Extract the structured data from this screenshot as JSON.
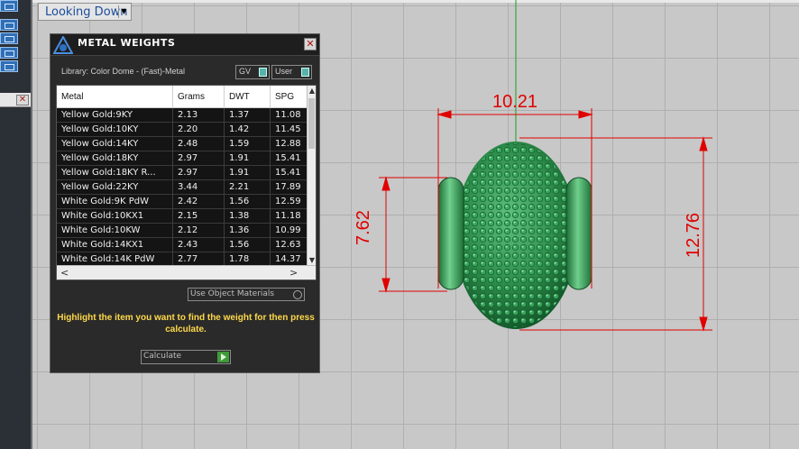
{
  "view": {
    "tab_label": "Looking Down",
    "dropdown_icon": "chevron-down-icon"
  },
  "dialog": {
    "title": "METAL WEIGHTS",
    "library": "Library: Color Dome - (Fast)-Metal",
    "toggles": [
      {
        "label": "GV"
      },
      {
        "label": "User"
      }
    ],
    "columns": [
      "Metal",
      "Grams",
      "DWT",
      "SPG"
    ],
    "rows": [
      {
        "metal": "Yellow Gold:9KY",
        "grams": "2.13",
        "dwt": "1.37",
        "spg": "11.08"
      },
      {
        "metal": "Yellow Gold:10KY",
        "grams": "2.20",
        "dwt": "1.42",
        "spg": "11.45"
      },
      {
        "metal": "Yellow Gold:14KY",
        "grams": "2.48",
        "dwt": "1.59",
        "spg": "12.88"
      },
      {
        "metal": "Yellow Gold:18KY",
        "grams": "2.97",
        "dwt": "1.91",
        "spg": "15.41"
      },
      {
        "metal": "Yellow Gold:18KY R...",
        "grams": "2.97",
        "dwt": "1.91",
        "spg": "15.41"
      },
      {
        "metal": "Yellow Gold:22KY",
        "grams": "3.44",
        "dwt": "2.21",
        "spg": "17.89"
      },
      {
        "metal": "White Gold:9K PdW",
        "grams": "2.42",
        "dwt": "1.56",
        "spg": "12.59"
      },
      {
        "metal": "White Gold:10KX1",
        "grams": "2.15",
        "dwt": "1.38",
        "spg": "11.18"
      },
      {
        "metal": "White Gold:10KW",
        "grams": "2.12",
        "dwt": "1.36",
        "spg": "10.99"
      },
      {
        "metal": "White Gold:14KX1",
        "grams": "2.43",
        "dwt": "1.56",
        "spg": "12.63"
      },
      {
        "metal": "White Gold:14K PdW",
        "grams": "2.77",
        "dwt": "1.78",
        "spg": "14.37"
      }
    ],
    "use_object_materials": "Use Object Materials",
    "hint": "Highlight the item you want to find the weight for then press calculate.",
    "calculate": "Calculate"
  },
  "dimensions": {
    "width": "10.21",
    "left_height": "7.62",
    "right_height": "12.76"
  },
  "colors": {
    "dimension": "#e00000",
    "model": "#2f9a4f",
    "hint": "#ffd94a"
  }
}
